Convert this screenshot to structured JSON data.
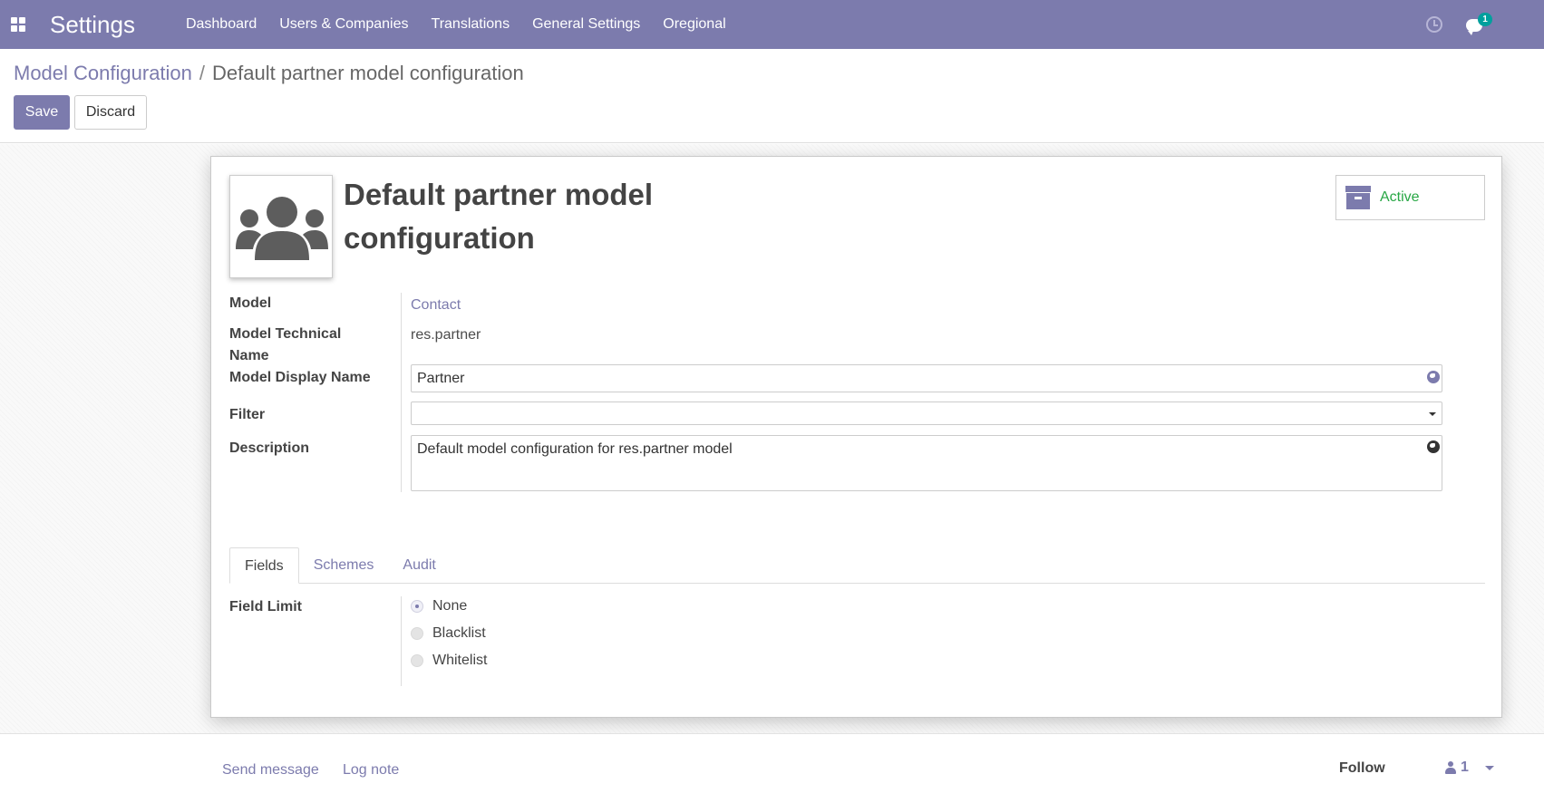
{
  "navbar": {
    "app_name": "Settings",
    "menu": [
      "Dashboard",
      "Users & Companies",
      "Translations",
      "General Settings",
      "Oregional"
    ],
    "messages_badge": "1",
    "color": "#7c7bad"
  },
  "breadcrumb": {
    "parent": "Model Configuration",
    "separator": "/",
    "current": "Default partner model configuration"
  },
  "actions": {
    "save": "Save",
    "discard": "Discard"
  },
  "record": {
    "title": "Default partner model configuration",
    "active_label": "Active",
    "avatar_icon": "users-icon"
  },
  "fields": {
    "model_label": "Model",
    "model_value": "Contact",
    "technical_label": "Model Technical Name",
    "technical_value": "res.partner",
    "display_label": "Model Display Name",
    "display_value": "Partner",
    "filter_label": "Filter",
    "filter_value": "",
    "description_label": "Description",
    "description_value": "Default model configuration for res.partner model"
  },
  "tabs": [
    "Fields",
    "Schemes",
    "Audit"
  ],
  "active_tab": "Fields",
  "field_limit": {
    "label": "Field Limit",
    "options": [
      "None",
      "Blacklist",
      "Whitelist"
    ],
    "selected": "None"
  },
  "chatter": {
    "send_message": "Send message",
    "log_note": "Log note",
    "follow": "Follow",
    "followers_count": "1"
  },
  "colors": {
    "primary": "#7c7bad",
    "active_green": "#28a745",
    "badge": "#00a09d"
  }
}
